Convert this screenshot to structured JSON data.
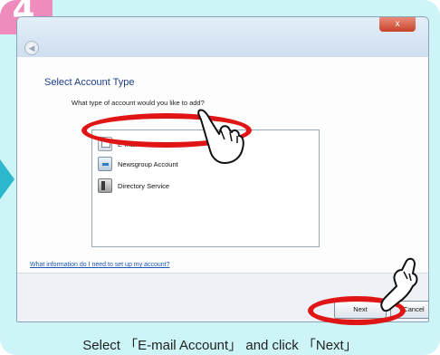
{
  "step": {
    "number": "4"
  },
  "dialog": {
    "close_label": "x",
    "heading": "Select Account Type",
    "question": "What type of account would you like to add?",
    "account_types": [
      {
        "label": "E-mail Account",
        "icon": "email-account-icon",
        "selected": true
      },
      {
        "label": "Newsgroup Account",
        "icon": "newsgroup-account-icon",
        "selected": false
      },
      {
        "label": "Directory Service",
        "icon": "directory-service-icon",
        "selected": false
      }
    ],
    "help_link": "What information do I need to set up my account?",
    "next_label": "Next",
    "cancel_label": "Cancel"
  },
  "caption": "Select 「E-mail Account」 and click 「Next」",
  "colors": {
    "panel": "#cdf5f8",
    "badge": "#f08bbd",
    "highlight": "#e01616",
    "arrow": "#2bb7cc",
    "link": "#1a56b5"
  }
}
